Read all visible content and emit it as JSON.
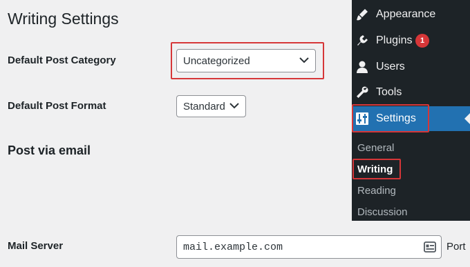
{
  "page": {
    "title": "Writing Settings"
  },
  "form": {
    "default_category": {
      "label": "Default Post Category",
      "value": "Uncategorized"
    },
    "default_format": {
      "label": "Default Post Format",
      "value": "Standard"
    },
    "post_via_email": {
      "heading": "Post via email"
    },
    "mail_server": {
      "label": "Mail Server",
      "value": "mail.example.com",
      "trailing_label": "Port"
    }
  },
  "admin_menu": {
    "items": [
      {
        "label": "Appearance",
        "icon": "paintbrush-icon"
      },
      {
        "label": "Plugins",
        "icon": "plugin-icon",
        "badge": "1"
      },
      {
        "label": "Users",
        "icon": "user-icon"
      },
      {
        "label": "Tools",
        "icon": "wrench-icon"
      },
      {
        "label": "Settings",
        "icon": "settings-icon",
        "current": true
      }
    ],
    "submenu": [
      {
        "label": "General"
      },
      {
        "label": "Writing",
        "current": true
      },
      {
        "label": "Reading"
      },
      {
        "label": "Discussion"
      }
    ]
  },
  "colors": {
    "highlight_red": "#d63638",
    "menu_bg": "#1d2327",
    "menu_current": "#2271b1",
    "badge": "#d63638"
  }
}
